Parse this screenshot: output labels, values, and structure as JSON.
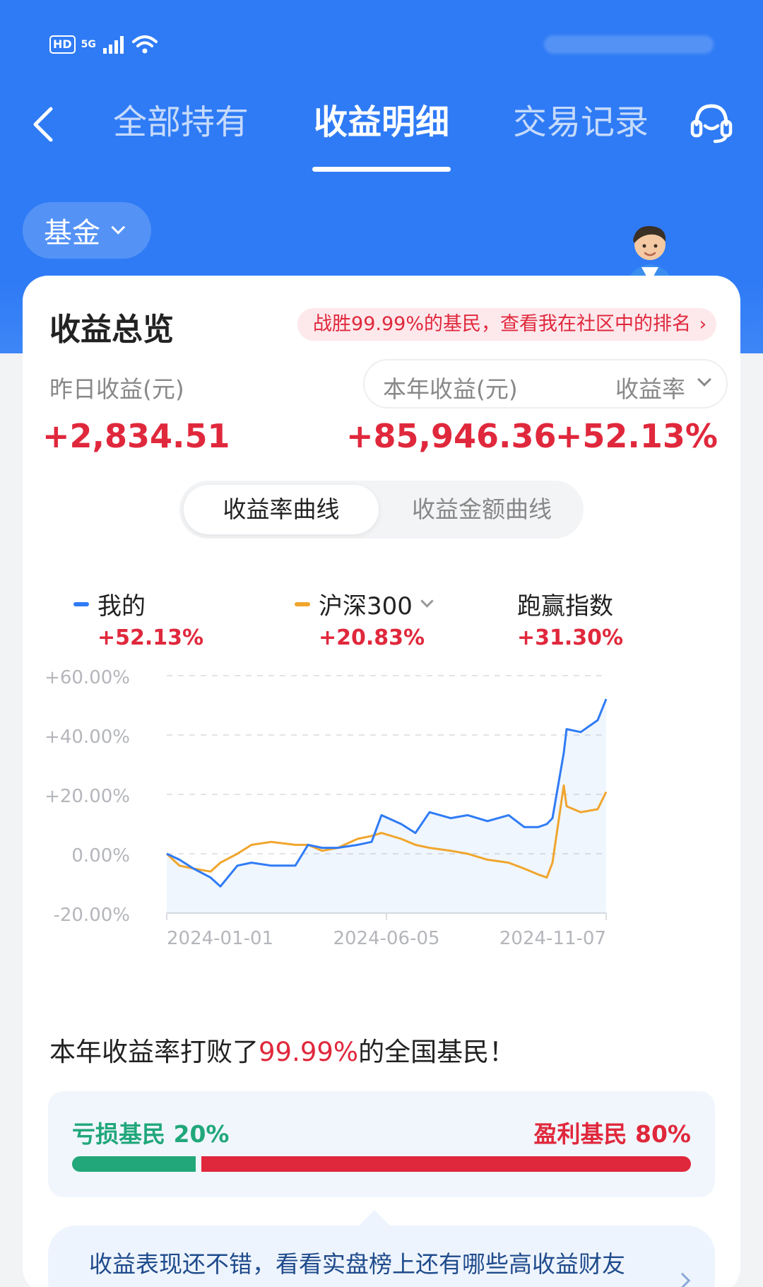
{
  "status_bar": {
    "hd": "HD",
    "network": "5G"
  },
  "nav": {
    "tabs": [
      {
        "label": "全部持有",
        "active": false
      },
      {
        "label": "收益明细",
        "active": true
      },
      {
        "label": "交易记录",
        "active": false
      }
    ]
  },
  "filter": {
    "label": "基金"
  },
  "overview": {
    "title": "收益总览",
    "rank_banner": "战胜99.99%的基民，查看我在社区中的排名",
    "yesterday_label": "昨日收益(元)",
    "yesterday_value": "+2,834.51",
    "year_label": "本年收益(元)",
    "year_value": "+85,946.36",
    "rate_label": "收益率",
    "rate_value": "+52.13%"
  },
  "segment": {
    "options": [
      "收益率曲线",
      "收益金额曲线"
    ],
    "selected": 0
  },
  "legend": {
    "mine": {
      "name": "我的",
      "value": "+52.13%",
      "color": "#2f7bf5"
    },
    "index": {
      "name": "沪深300",
      "value": "+20.83%",
      "color": "#f0a52d"
    },
    "excess": {
      "name": "跑赢指数",
      "value": "+31.30%"
    }
  },
  "chart_data": {
    "type": "line",
    "x_start": "2024-01-01",
    "x_end": "2024-11-07",
    "x_tick_labels": [
      "2024-01-01",
      "2024-06-05",
      "2024-11-07"
    ],
    "y_tick_labels": [
      "+60.00%",
      "+40.00%",
      "+20.00%",
      "0.00%",
      "-20.00%"
    ],
    "ylim": [
      -20,
      60
    ],
    "grid": true,
    "series": [
      {
        "name": "我的",
        "color": "#2f7bf5",
        "x": [
          "2024-01-01",
          "2024-01-10",
          "2024-01-20",
          "2024-02-01",
          "2024-02-08",
          "2024-02-20",
          "2024-03-01",
          "2024-03-15",
          "2024-04-01",
          "2024-04-10",
          "2024-04-20",
          "2024-05-01",
          "2024-05-15",
          "2024-05-25",
          "2024-06-01",
          "2024-06-15",
          "2024-06-25",
          "2024-07-05",
          "2024-07-20",
          "2024-08-01",
          "2024-08-15",
          "2024-08-30",
          "2024-09-10",
          "2024-09-20",
          "2024-09-26",
          "2024-09-30",
          "2024-10-08",
          "2024-10-10",
          "2024-10-20",
          "2024-11-01",
          "2024-11-07"
        ],
        "values": [
          0,
          -2,
          -5,
          -8,
          -11,
          -4,
          -3,
          -4,
          -4,
          3,
          2,
          2,
          3,
          4,
          13,
          10,
          7,
          14,
          12,
          13,
          11,
          13,
          9,
          9,
          10,
          12,
          34,
          42,
          41,
          45,
          52.13
        ]
      },
      {
        "name": "沪深300",
        "color": "#f0a52d",
        "x": [
          "2024-01-01",
          "2024-01-10",
          "2024-01-20",
          "2024-02-01",
          "2024-02-08",
          "2024-02-20",
          "2024-03-01",
          "2024-03-15",
          "2024-04-01",
          "2024-04-10",
          "2024-04-20",
          "2024-05-01",
          "2024-05-15",
          "2024-05-25",
          "2024-06-01",
          "2024-06-15",
          "2024-06-25",
          "2024-07-05",
          "2024-07-20",
          "2024-08-01",
          "2024-08-15",
          "2024-08-30",
          "2024-09-10",
          "2024-09-20",
          "2024-09-26",
          "2024-09-30",
          "2024-10-08",
          "2024-10-10",
          "2024-10-20",
          "2024-11-01",
          "2024-11-07"
        ],
        "values": [
          0,
          -4,
          -5,
          -6,
          -3,
          0,
          3,
          4,
          3,
          3,
          1,
          2,
          5,
          6,
          7,
          5,
          3,
          2,
          1,
          0,
          -2,
          -3,
          -5,
          -7,
          -8,
          -3,
          23,
          16,
          14,
          15,
          20.83
        ]
      }
    ]
  },
  "beat_text": {
    "prefix": "本年收益率打败了",
    "highlight": "99.99%",
    "suffix": "的全国基民！"
  },
  "distribution": {
    "loss_label": "亏损基民 20%",
    "gain_label": "盈利基民 80%",
    "loss_fraction": 0.2,
    "loss_color": "#21a77a",
    "gain_color": "#e0283c"
  },
  "tip": {
    "text": "收益表现还不错，看看实盘榜上还有哪些高收益财友"
  }
}
